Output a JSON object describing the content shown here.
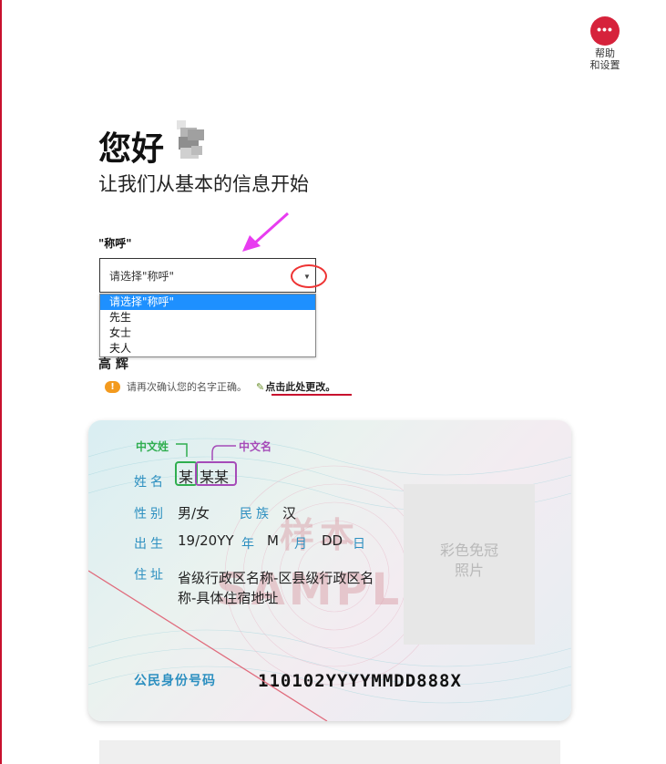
{
  "help": {
    "icon_glyph": "•••",
    "label_line1": "帮助",
    "label_line2": "和设置"
  },
  "header": {
    "greeting": "您好",
    "subtitle": "让我们从基本的信息开始"
  },
  "salutation": {
    "label": "\"称呼\"",
    "selected_value": "请选择\"称呼\"",
    "options": [
      "请选择\"称呼\"",
      "先生",
      "女士",
      "夫人"
    ]
  },
  "name_partial": "高 辉",
  "notice": {
    "icon": "!",
    "text": "请再次确认您的名字正确。",
    "pencil_icon": "✎",
    "edit_link": "点击此处更改。"
  },
  "id_card": {
    "annotation_surname": "中文姓",
    "annotation_given": "中文名",
    "name_label": "姓名",
    "name_surname": "某",
    "name_given": "某某",
    "sex_label": "性别",
    "sex_value": "男/女",
    "ethnicity_label": "民族",
    "ethnicity_value": "汉",
    "birth_label": "出生",
    "birth_year": "19/20YY",
    "year_label": "年",
    "birth_month": "M",
    "month_label": "月",
    "birth_day": "DD",
    "day_label": "日",
    "address_label": "住址",
    "address_line1": "省级行政区名称-区县级行政区名",
    "address_line2": "称-具体住宿地址",
    "photo_line1": "彩色免冠",
    "photo_line2": "照片",
    "id_label": "公民身份号码",
    "id_number": "110102YYYYMMDD888X",
    "watermark_cn": "样本",
    "watermark_en": "SAMPLE"
  },
  "colors": {
    "accent": "#d6223b",
    "dropdown_highlight": "#1e90ff",
    "warning": "#f39a1e",
    "card_label": "#2c8fc0"
  }
}
